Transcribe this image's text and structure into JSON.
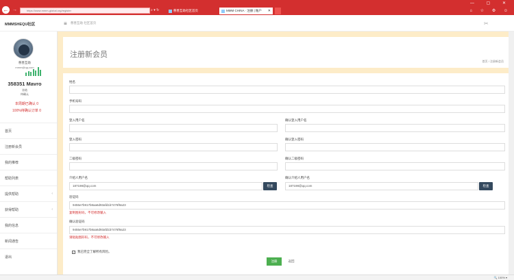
{
  "browser": {
    "back_icon": "←",
    "forward_icon": "→",
    "address": "https://www.mmm-global.org/register",
    "tabs": [
      {
        "title": "慈善互助社区首页"
      },
      {
        "title": "MMM CHINA · 注册 | 账户"
      }
    ],
    "window_controls": "— ▢ ✕",
    "right_icons": "⌂ ☆ ⚙ ☺"
  },
  "header": {
    "brand": "MMMSHEQU社区",
    "menu_icon": "≡",
    "breadcrumb_text": "慈善互助 社区首页",
    "tool_icon": "✂"
  },
  "sidebar": {
    "profile_name": "慈善互助",
    "profile_email": "mmm@qq.com",
    "bar_heights": [
      0.35,
      0.55,
      0.45,
      0.8,
      0.6,
      1.0,
      0.7
    ],
    "mavro_total": "358351 Mavro",
    "mavro_sub1": "冻结",
    "mavro_sub2": "待确认",
    "red_line1": "本周期已确认 0",
    "red_line2": "100%待确认订单 0",
    "menu": [
      {
        "label": "首页"
      },
      {
        "label": "注册新会员"
      },
      {
        "label": "我的推荐"
      },
      {
        "label": "帮助列表"
      },
      {
        "label": "提供帮助",
        "chevron": "‹"
      },
      {
        "label": "获得帮助",
        "chevron": "‹"
      },
      {
        "label": "我的信息"
      },
      {
        "label": "新闻通告"
      },
      {
        "label": "退出"
      }
    ]
  },
  "main": {
    "page_title": "注册新会员",
    "breadcrumb": "首页 / 注册新会员"
  },
  "form": {
    "name_label": "姓名",
    "name_value": "",
    "phone_label": "手机号码",
    "phone_value": "",
    "user_label": "登入用户名",
    "user_value": "",
    "user_confirm_label": "确认登入用户名",
    "user_confirm_value": "",
    "pwd_label": "登入密码",
    "pwd_value": "",
    "pwd_confirm_label": "确认登入密码",
    "pwd_confirm_value": "",
    "pwd2_label": "二级密码",
    "pwd2_value": "",
    "pwd2_confirm_label": "确认二级密码",
    "pwd2_confirm_value": "",
    "referrer_label": "介绍人用户名",
    "referrer_value": "187198@qq.com",
    "referrer_check": "检查",
    "referrer_confirm_label": "确认介绍人用户名",
    "referrer_confirm_value": "187198@qq.com",
    "referrer_confirm_check": "检查",
    "code_label": "验证码",
    "code_value": "9455e7b917b8aa6d93afd1b7476f9a23",
    "code_note": "复制图形码，不可修改输入",
    "code_confirm_label": "确认验证码",
    "code_confirm_value": "9455e7b917b8aa6d93afd1b7476f9a23",
    "code_confirm_note": "请粘贴图形码，不可修改输入",
    "agree_text": "我已完全了解所有风险。",
    "agree_check": "✓",
    "register_button": "注册",
    "cancel_button": "返回"
  },
  "status": {
    "zoom": "🔍 100% ▾"
  }
}
